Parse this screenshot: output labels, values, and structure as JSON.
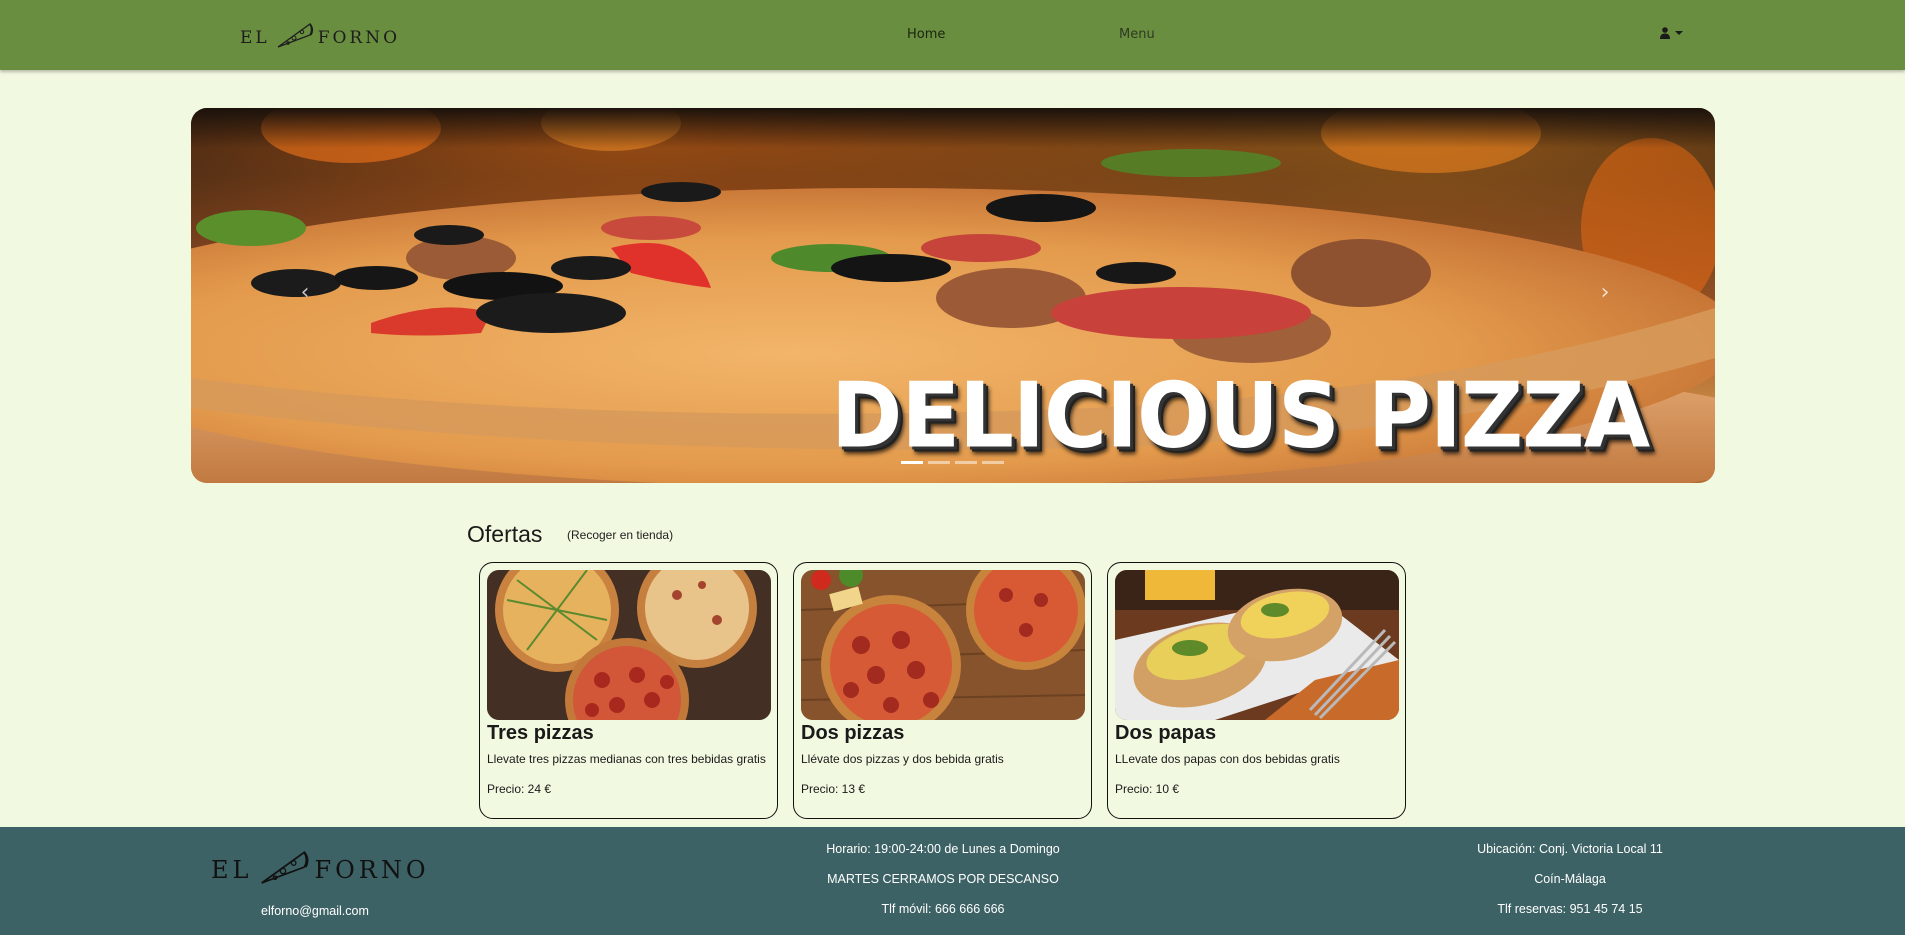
{
  "navbar": {
    "logo_left": "EL",
    "logo_right": "FORNO",
    "links": [
      {
        "label": "Home"
      },
      {
        "label": "Menu"
      }
    ],
    "user_icon": "user-icon"
  },
  "carousel": {
    "caption": "DELICIOUS PIZZA",
    "slide_count": 4,
    "active_slide": 1,
    "prev_icon": "chevron-left-icon",
    "next_icon": "chevron-right-icon"
  },
  "offers": {
    "title": "Ofertas",
    "subtitle": "(Recoger en tienda)",
    "cards": [
      {
        "title": "Tres pizzas",
        "description": "Llevate tres pizzas medianas con tres bebidas gratis",
        "price": "Precio: 24 €"
      },
      {
        "title": "Dos pizzas",
        "description": "Llévate dos pizzas y dos bebida gratis",
        "price": "Precio: 13 €"
      },
      {
        "title": "Dos papas",
        "description": "LLevate dos papas con dos bebidas gratis",
        "price": "Precio: 10 €"
      }
    ]
  },
  "footer": {
    "logo_left": "EL",
    "logo_right": "FORNO",
    "email": "elforno@gmail.com",
    "schedule": "Horario: 19:00-24:00 de Lunes a Domingo",
    "closed_notice": "MARTES CERRAMOS POR DESCANSO",
    "mobile": "Tlf móvil: 666 666 666",
    "location": "Ubicación: Conj. Victoria Local 11",
    "city": "Coín-Málaga",
    "reservations": "Tlf reservas: 951 45 74 15"
  },
  "colors": {
    "navbar": "#6a8e3f",
    "page_bg": "#f2f9e1",
    "footer": "#3d6265"
  }
}
